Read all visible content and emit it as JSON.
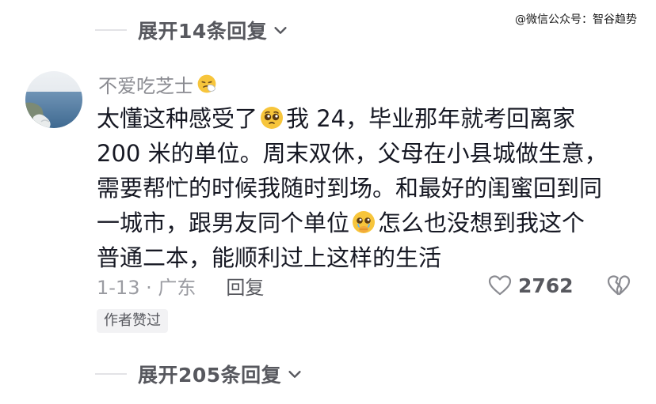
{
  "expand_top": {
    "label": "展开14条回复"
  },
  "expand_bottom": {
    "label": "展开205条回复"
  },
  "watermark": {
    "text": "@微信公众号：智谷趋势"
  },
  "comment": {
    "username": "不爱吃芝士",
    "username_emoji": "sneezing-face",
    "lines": [
      {
        "a": "太懂这种感受了",
        "b": "我 24，毕业那年就考回离家"
      },
      {
        "a": "200 米的单位。周末双休，父母在小县城做生意，",
        "b": ""
      },
      {
        "a": "需要帮忙的时候我随时到场。和最好的闺蜜回到同",
        "b": ""
      },
      {
        "a": "一城市，跟男友同个单位",
        "b": "怎么也没想到我这个"
      },
      {
        "a": "普通二本，能顺利过上这样的生活",
        "b": ""
      }
    ],
    "emojis": [
      "pleading-face",
      "holding-back-tears-face"
    ],
    "date_location": "1-13 · 广东",
    "reply_label": "回复",
    "like_count": "2762",
    "author_badge": "作者赞过"
  },
  "colors": {
    "text_primary": "#161823",
    "text_secondary": "#8a8b91",
    "text_meta": "#57585e",
    "badge_bg": "#f2f2f4",
    "emoji_yellow": "#f7c53b"
  },
  "icons": {
    "expand": "chevron-down-icon",
    "like": "heart-outline-icon",
    "dislike": "broken-heart-icon"
  }
}
